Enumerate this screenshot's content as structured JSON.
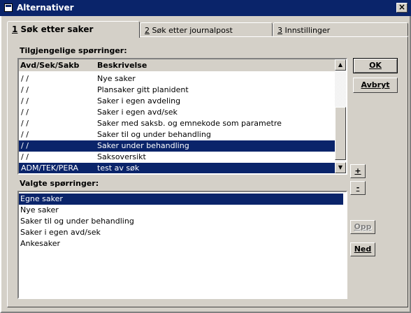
{
  "window": {
    "title": "Alternativer",
    "close_glyph": "×"
  },
  "tabs": [
    {
      "key": "1",
      "label": " Søk etter saker"
    },
    {
      "key": "2",
      "label": " Søk etter journalpost"
    },
    {
      "key": "3",
      "label": " Innstillinger"
    }
  ],
  "available": {
    "label": "Tilgjengelige spørringer:",
    "headers": {
      "code": "Avd/Sek/Sakb",
      "desc": "Beskrivelse"
    },
    "rows": [
      {
        "code": "/ /",
        "desc": "Nye saker",
        "selected": false
      },
      {
        "code": "/ /",
        "desc": "Plansaker gitt planident",
        "selected": false
      },
      {
        "code": "/ /",
        "desc": "Saker i egen avdeling",
        "selected": false
      },
      {
        "code": "/ /",
        "desc": "Saker i egen avd/sek",
        "selected": false
      },
      {
        "code": "/ /",
        "desc": "Saker med saksb. og emnekode som parametre",
        "selected": false
      },
      {
        "code": "/ /",
        "desc": "Saker til og under behandling",
        "selected": false
      },
      {
        "code": "/ /",
        "desc": "Saker under behandling",
        "selected": true
      },
      {
        "code": "/ /",
        "desc": "Saksoversikt",
        "selected": false
      },
      {
        "code": "ADM/TEK/PERA",
        "desc": "test av søk",
        "selected": true
      }
    ]
  },
  "selected_queries": {
    "label": "Valgte spørringer:",
    "rows": [
      {
        "text": "Egne saker",
        "selected": true
      },
      {
        "text": "Nye saker",
        "selected": false
      },
      {
        "text": "Saker til og under behandling",
        "selected": false
      },
      {
        "text": "Saker i egen avd/sek",
        "selected": false
      },
      {
        "text": "Ankesaker",
        "selected": false
      }
    ]
  },
  "buttons": {
    "ok": "OK",
    "cancel": "Avbryt",
    "add": "+",
    "remove": "-",
    "up": "Opp",
    "down": "Ned"
  },
  "scrollbar": {
    "up_glyph": "▲",
    "down_glyph": "▼"
  }
}
